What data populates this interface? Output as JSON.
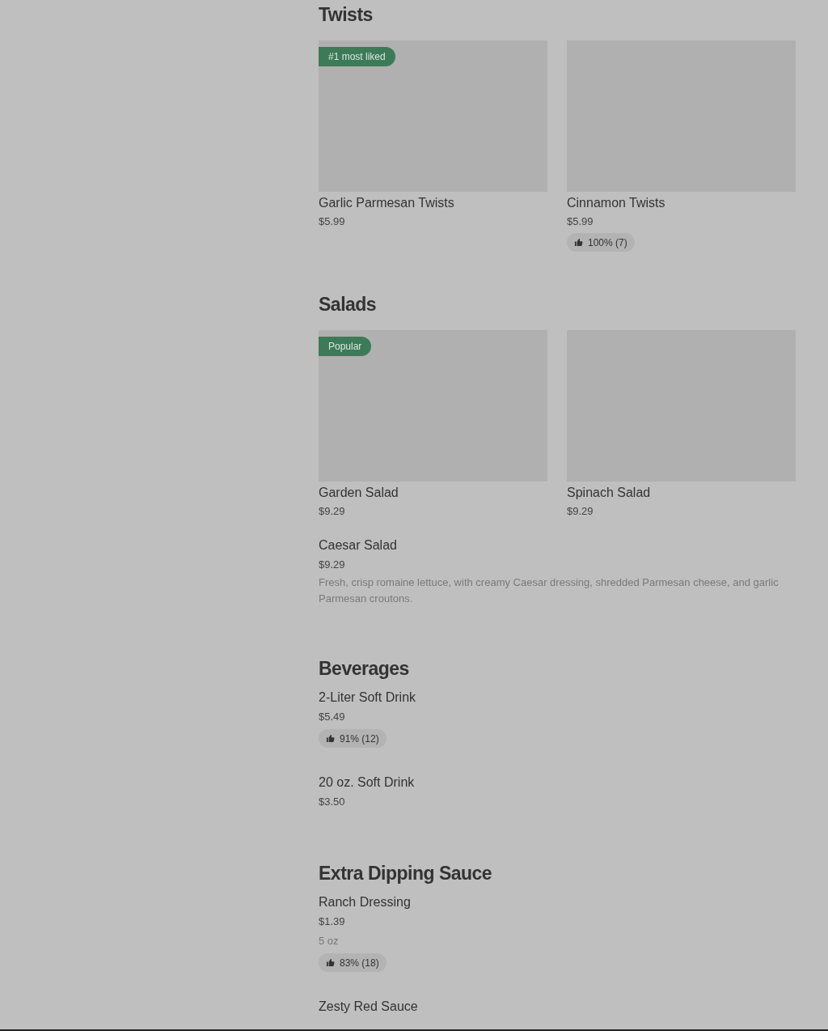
{
  "sections": [
    {
      "title": "Twists",
      "cards": [
        {
          "name": "Garlic Parmesan Twists",
          "price": "$5.99",
          "badge": "#1 most liked"
        },
        {
          "name": "Cinnamon Twists",
          "price": "$5.99",
          "rating": "100% (7)"
        }
      ]
    },
    {
      "title": "Salads",
      "cards": [
        {
          "name": "Garden Salad",
          "price": "$9.29",
          "badge": "Popular"
        },
        {
          "name": "Spinach Salad",
          "price": "$9.29"
        }
      ],
      "rows": [
        {
          "name": "Caesar Salad",
          "price": "$9.29",
          "description": "Fresh, crisp romaine lettuce, with creamy Caesar dressing, shredded Parmesan cheese, and garlic Parmesan croutons."
        }
      ]
    },
    {
      "title": "Beverages",
      "rows": [
        {
          "name": "2-Liter Soft Drink",
          "price": "$5.49",
          "rating": "91% (12)"
        },
        {
          "name": "20 oz. Soft Drink",
          "price": "$3.50"
        }
      ]
    },
    {
      "title": "Extra Dipping Sauce",
      "rows": [
        {
          "name": "Ranch Dressing",
          "price": "$1.39",
          "size": "5 oz",
          "rating": "83% (18)"
        },
        {
          "name": "Zesty Red Sauce"
        }
      ]
    }
  ]
}
